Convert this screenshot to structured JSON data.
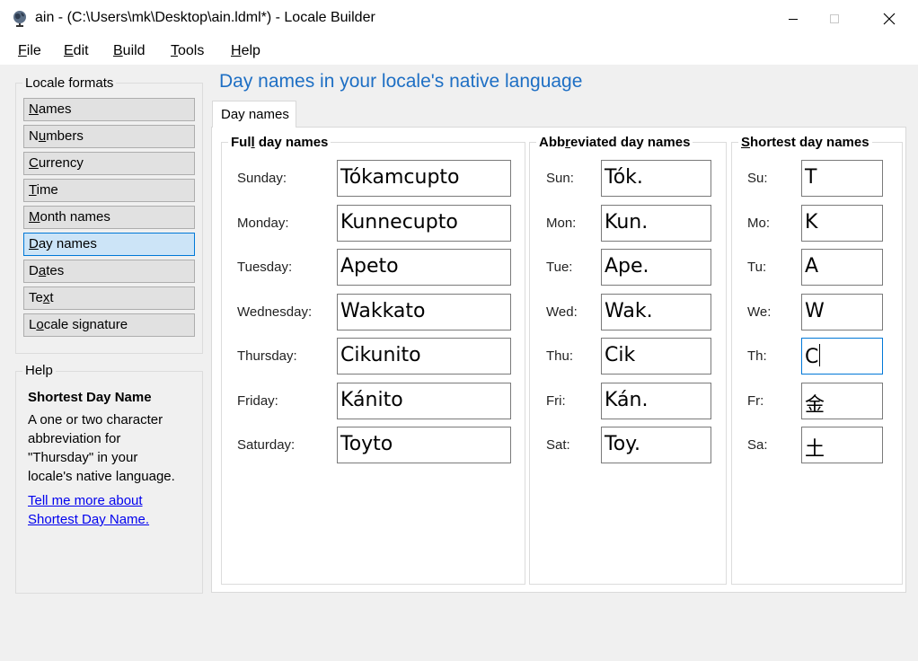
{
  "window": {
    "title": "ain - (C:\\Users\\mk\\Desktop\\ain.ldml*) - Locale Builder"
  },
  "menu": [
    {
      "label": "File",
      "mnemonic_index": 0
    },
    {
      "label": "Edit",
      "mnemonic_index": 0
    },
    {
      "label": "Build",
      "mnemonic_index": 0
    },
    {
      "label": "Tools",
      "mnemonic_index": 0
    },
    {
      "label": "Help",
      "mnemonic_index": 0
    }
  ],
  "sidebar": {
    "title": "Locale formats",
    "items": [
      {
        "label": "Names",
        "mnemonic_index": 0,
        "selected": false
      },
      {
        "label": "Numbers",
        "mnemonic_index": 1,
        "selected": false
      },
      {
        "label": "Currency",
        "mnemonic_index": 0,
        "selected": false
      },
      {
        "label": "Time",
        "mnemonic_index": 0,
        "selected": false
      },
      {
        "label": "Month names",
        "mnemonic_index": 0,
        "selected": false
      },
      {
        "label": "Day names",
        "mnemonic_index": 0,
        "selected": true
      },
      {
        "label": "Dates",
        "mnemonic_index": 1,
        "selected": false
      },
      {
        "label": "Text",
        "mnemonic_index": 2,
        "selected": false
      },
      {
        "label": "Locale signature",
        "mnemonic_index": 1,
        "selected": false
      }
    ]
  },
  "help": {
    "title": "Help",
    "topic": "Shortest Day Name",
    "body_lines": [
      "A one or two character",
      "abbreviation for",
      "\"Thursday\" in your",
      "locale's native language."
    ],
    "link_lines": [
      "Tell me more about",
      "Shortest Day Name."
    ]
  },
  "main": {
    "heading": "Day names in your locale's native language",
    "tab_label": "Day names"
  },
  "groups": {
    "full": {
      "title": "Full day names",
      "mnemonic_index": 3,
      "labels": [
        "Sunday:",
        "Monday:",
        "Tuesday:",
        "Wednesday:",
        "Thursday:",
        "Friday:",
        "Saturday:"
      ],
      "values": [
        "Tókamcupto",
        "Kunnecupto",
        "Apeto",
        "Wakkato",
        "Cikunito",
        "Kánito",
        "Toyto"
      ]
    },
    "abbreviated": {
      "title": "Abbreviated day names",
      "mnemonic_index": 3,
      "labels": [
        "Sun:",
        "Mon:",
        "Tue:",
        "Wed:",
        "Thu:",
        "Fri:",
        "Sat:"
      ],
      "values": [
        "Tók.",
        "Kun.",
        "Ape.",
        "Wak.",
        "Cik",
        "Kán.",
        "Toy."
      ]
    },
    "shortest": {
      "title": "Shortest day names",
      "mnemonic_index": 0,
      "labels": [
        "Su:",
        "Mo:",
        "Tu:",
        "We:",
        "Th:",
        "Fr:",
        "Sa:"
      ],
      "values": [
        "T",
        "K",
        "A",
        "W",
        "C",
        "金",
        "土"
      ],
      "focused_index": 4
    }
  }
}
